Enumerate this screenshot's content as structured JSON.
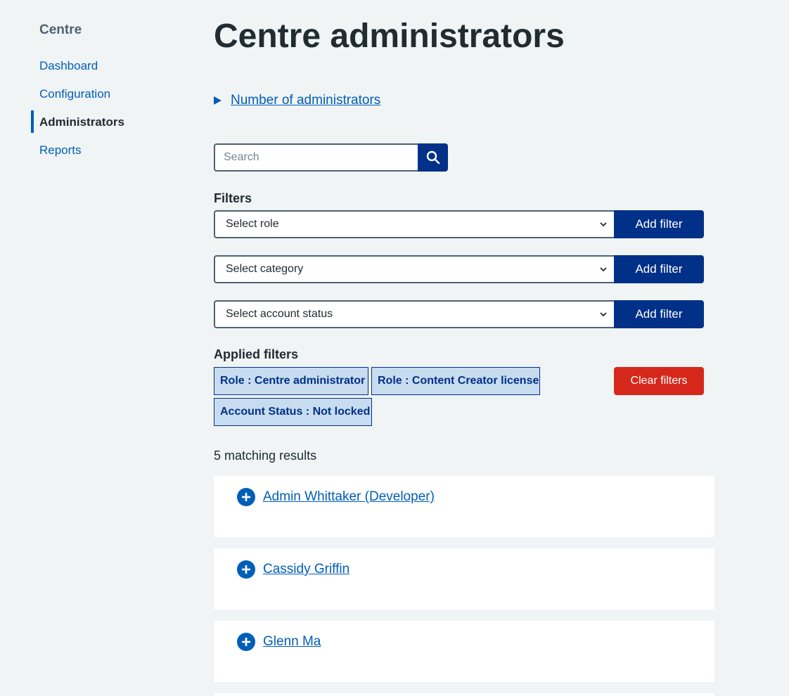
{
  "sidebar": {
    "title": "Centre",
    "items": [
      {
        "label": "Dashboard"
      },
      {
        "label": "Configuration"
      },
      {
        "label": "Administrators"
      },
      {
        "label": "Reports"
      }
    ],
    "active_item": "Administrators"
  },
  "main": {
    "title": "Centre administrators",
    "details_summary": "Number of administrators",
    "search": {
      "placeholder": "Search",
      "value": ""
    },
    "filters_heading": "Filters",
    "filters": [
      {
        "select_value": "Select role",
        "button_label": "Add filter"
      },
      {
        "select_value": "Select category",
        "button_label": "Add filter"
      },
      {
        "select_value": "Select account status",
        "button_label": "Add filter"
      }
    ],
    "applied_filters_heading": "Applied filters",
    "applied_filters": [
      "Role : Centre administrator",
      "Role : Content Creator license",
      "Account Status : Not locked"
    ],
    "clear_filters_label": "Clear filters",
    "results_count": "5 matching results",
    "results": [
      {
        "name": "Admin Whittaker (Developer)"
      },
      {
        "name": "Cassidy Griffin"
      },
      {
        "name": "Glenn Ma"
      }
    ]
  },
  "colors": {
    "background": "#f0f4f5",
    "link": "#005eb8",
    "primary_button": "#003087",
    "danger_button": "#d5281b",
    "tag_background": "#c8dcf0",
    "text": "#212b32"
  },
  "icons": {
    "search_button": "search-icon",
    "details": "triangle-right-icon",
    "select": "chevron-down-icon",
    "result_expand": "plus-circle-icon"
  }
}
